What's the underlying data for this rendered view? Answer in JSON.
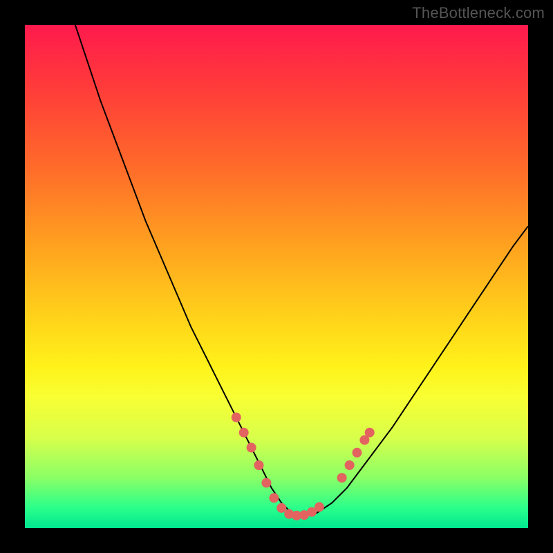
{
  "watermark": "TheBottleneck.com",
  "chart_data": {
    "type": "line",
    "title": "",
    "xlabel": "",
    "ylabel": "",
    "xlim": [
      0,
      100
    ],
    "ylim": [
      0,
      100
    ],
    "grid": false,
    "series": [
      {
        "name": "curve",
        "color": "#000000",
        "x": [
          10,
          12,
          15,
          18,
          21,
          24,
          27,
          30,
          33,
          36,
          39,
          42,
          45,
          47,
          49,
          51,
          53,
          55,
          58,
          61,
          64,
          67,
          70,
          73,
          76,
          79,
          82,
          85,
          88,
          91,
          94,
          97,
          100
        ],
        "y": [
          100,
          94,
          85,
          77,
          69,
          61,
          54,
          47,
          40,
          34,
          28,
          22,
          16,
          12,
          8,
          5,
          3,
          2.5,
          3,
          5,
          8,
          12,
          16,
          20,
          24.5,
          29,
          33.5,
          38,
          42.5,
          47,
          51.5,
          56,
          60
        ]
      }
    ],
    "markers": {
      "name": "highlight-points",
      "color": "#e2635f",
      "points": [
        {
          "x": 42,
          "y": 22
        },
        {
          "x": 43.5,
          "y": 19
        },
        {
          "x": 45,
          "y": 16
        },
        {
          "x": 46.5,
          "y": 12.5
        },
        {
          "x": 48,
          "y": 9
        },
        {
          "x": 49.5,
          "y": 6
        },
        {
          "x": 51,
          "y": 4
        },
        {
          "x": 52.5,
          "y": 2.8
        },
        {
          "x": 54,
          "y": 2.5
        },
        {
          "x": 55.5,
          "y": 2.6
        },
        {
          "x": 57,
          "y": 3.2
        },
        {
          "x": 58.5,
          "y": 4.2
        },
        {
          "x": 63,
          "y": 10
        },
        {
          "x": 64.5,
          "y": 12.5
        },
        {
          "x": 66,
          "y": 15
        },
        {
          "x": 67.5,
          "y": 17.5
        },
        {
          "x": 68.5,
          "y": 19
        }
      ]
    }
  }
}
